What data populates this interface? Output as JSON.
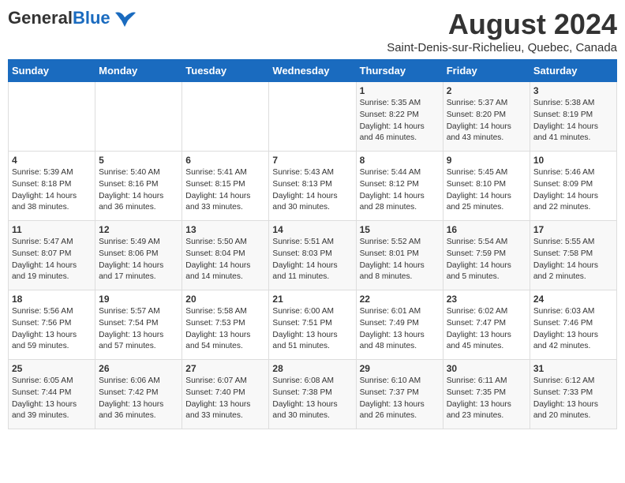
{
  "logo": {
    "general": "General",
    "blue": "Blue"
  },
  "title": "August 2024",
  "subtitle": "Saint-Denis-sur-Richelieu, Quebec, Canada",
  "days": [
    "Sunday",
    "Monday",
    "Tuesday",
    "Wednesday",
    "Thursday",
    "Friday",
    "Saturday"
  ],
  "weeks": [
    [
      {
        "date": "",
        "content": ""
      },
      {
        "date": "",
        "content": ""
      },
      {
        "date": "",
        "content": ""
      },
      {
        "date": "",
        "content": ""
      },
      {
        "date": "1",
        "content": "Sunrise: 5:35 AM\nSunset: 8:22 PM\nDaylight: 14 hours\nand 46 minutes."
      },
      {
        "date": "2",
        "content": "Sunrise: 5:37 AM\nSunset: 8:20 PM\nDaylight: 14 hours\nand 43 minutes."
      },
      {
        "date": "3",
        "content": "Sunrise: 5:38 AM\nSunset: 8:19 PM\nDaylight: 14 hours\nand 41 minutes."
      }
    ],
    [
      {
        "date": "4",
        "content": "Sunrise: 5:39 AM\nSunset: 8:18 PM\nDaylight: 14 hours\nand 38 minutes."
      },
      {
        "date": "5",
        "content": "Sunrise: 5:40 AM\nSunset: 8:16 PM\nDaylight: 14 hours\nand 36 minutes."
      },
      {
        "date": "6",
        "content": "Sunrise: 5:41 AM\nSunset: 8:15 PM\nDaylight: 14 hours\nand 33 minutes."
      },
      {
        "date": "7",
        "content": "Sunrise: 5:43 AM\nSunset: 8:13 PM\nDaylight: 14 hours\nand 30 minutes."
      },
      {
        "date": "8",
        "content": "Sunrise: 5:44 AM\nSunset: 8:12 PM\nDaylight: 14 hours\nand 28 minutes."
      },
      {
        "date": "9",
        "content": "Sunrise: 5:45 AM\nSunset: 8:10 PM\nDaylight: 14 hours\nand 25 minutes."
      },
      {
        "date": "10",
        "content": "Sunrise: 5:46 AM\nSunset: 8:09 PM\nDaylight: 14 hours\nand 22 minutes."
      }
    ],
    [
      {
        "date": "11",
        "content": "Sunrise: 5:47 AM\nSunset: 8:07 PM\nDaylight: 14 hours\nand 19 minutes."
      },
      {
        "date": "12",
        "content": "Sunrise: 5:49 AM\nSunset: 8:06 PM\nDaylight: 14 hours\nand 17 minutes."
      },
      {
        "date": "13",
        "content": "Sunrise: 5:50 AM\nSunset: 8:04 PM\nDaylight: 14 hours\nand 14 minutes."
      },
      {
        "date": "14",
        "content": "Sunrise: 5:51 AM\nSunset: 8:03 PM\nDaylight: 14 hours\nand 11 minutes."
      },
      {
        "date": "15",
        "content": "Sunrise: 5:52 AM\nSunset: 8:01 PM\nDaylight: 14 hours\nand 8 minutes."
      },
      {
        "date": "16",
        "content": "Sunrise: 5:54 AM\nSunset: 7:59 PM\nDaylight: 14 hours\nand 5 minutes."
      },
      {
        "date": "17",
        "content": "Sunrise: 5:55 AM\nSunset: 7:58 PM\nDaylight: 14 hours\nand 2 minutes."
      }
    ],
    [
      {
        "date": "18",
        "content": "Sunrise: 5:56 AM\nSunset: 7:56 PM\nDaylight: 13 hours\nand 59 minutes."
      },
      {
        "date": "19",
        "content": "Sunrise: 5:57 AM\nSunset: 7:54 PM\nDaylight: 13 hours\nand 57 minutes."
      },
      {
        "date": "20",
        "content": "Sunrise: 5:58 AM\nSunset: 7:53 PM\nDaylight: 13 hours\nand 54 minutes."
      },
      {
        "date": "21",
        "content": "Sunrise: 6:00 AM\nSunset: 7:51 PM\nDaylight: 13 hours\nand 51 minutes."
      },
      {
        "date": "22",
        "content": "Sunrise: 6:01 AM\nSunset: 7:49 PM\nDaylight: 13 hours\nand 48 minutes."
      },
      {
        "date": "23",
        "content": "Sunrise: 6:02 AM\nSunset: 7:47 PM\nDaylight: 13 hours\nand 45 minutes."
      },
      {
        "date": "24",
        "content": "Sunrise: 6:03 AM\nSunset: 7:46 PM\nDaylight: 13 hours\nand 42 minutes."
      }
    ],
    [
      {
        "date": "25",
        "content": "Sunrise: 6:05 AM\nSunset: 7:44 PM\nDaylight: 13 hours\nand 39 minutes."
      },
      {
        "date": "26",
        "content": "Sunrise: 6:06 AM\nSunset: 7:42 PM\nDaylight: 13 hours\nand 36 minutes."
      },
      {
        "date": "27",
        "content": "Sunrise: 6:07 AM\nSunset: 7:40 PM\nDaylight: 13 hours\nand 33 minutes."
      },
      {
        "date": "28",
        "content": "Sunrise: 6:08 AM\nSunset: 7:38 PM\nDaylight: 13 hours\nand 30 minutes."
      },
      {
        "date": "29",
        "content": "Sunrise: 6:10 AM\nSunset: 7:37 PM\nDaylight: 13 hours\nand 26 minutes."
      },
      {
        "date": "30",
        "content": "Sunrise: 6:11 AM\nSunset: 7:35 PM\nDaylight: 13 hours\nand 23 minutes."
      },
      {
        "date": "31",
        "content": "Sunrise: 6:12 AM\nSunset: 7:33 PM\nDaylight: 13 hours\nand 20 minutes."
      }
    ]
  ]
}
